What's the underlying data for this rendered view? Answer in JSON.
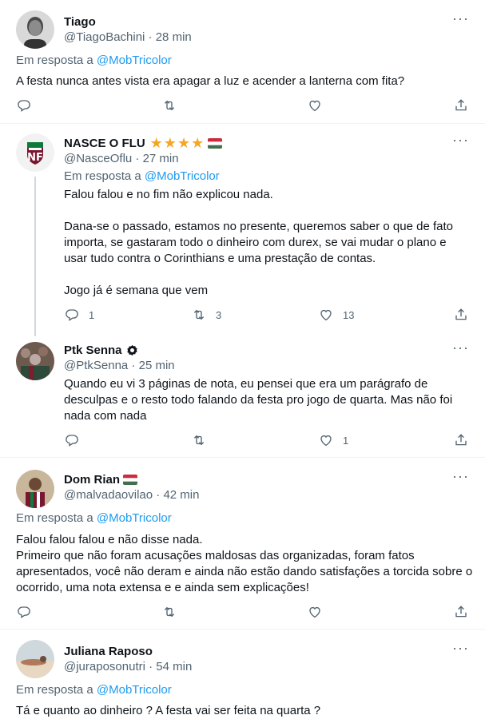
{
  "tweets": [
    {
      "name": "Tiago",
      "handle_time": "@TiagoBachini · 28 min",
      "reply_prefix": "Em resposta a",
      "reply_mention": "@MobTricolor",
      "text": "A festa nunca antes vista era apagar a luz e acender a lanterna com fita?",
      "replies": "",
      "retweets": "",
      "likes": ""
    },
    {
      "name": "NASCE O FLU",
      "handle_time": "@NasceOflu · 27 min",
      "reply_prefix": "Em resposta a",
      "reply_mention": "@MobTricolor",
      "text": "Falou falou e no fim não explicou nada.\n\nDana-se o passado, estamos no presente, queremos saber o que de fato importa, se gastaram todo o dinheiro com durex, se vai mudar o plano e usar tudo contra o Corinthians e uma prestação de contas.\n\nJogo já é semana que vem",
      "replies": "1",
      "retweets": "3",
      "likes": "13",
      "stars": "★★★★"
    },
    {
      "name": "Ptk Senna",
      "handle_time": "@PtkSenna · 25 min",
      "text": "Quando eu vi 3 páginas de nota, eu pensei que era um parágrafo de desculpas e o resto todo falando da festa pro jogo de quarta. Mas não foi nada com nada",
      "replies": "",
      "retweets": "",
      "likes": "1"
    },
    {
      "name": "Dom Rian",
      "handle_time": "@malvadaovilao · 42 min",
      "reply_prefix": "Em resposta a",
      "reply_mention": "@MobTricolor",
      "text": "Falou falou falou e não disse nada.\nPrimeiro que não foram acusações maldosas das organizadas, foram fatos apresentados, você não deram e ainda não estão dando satisfações a torcida sobre o ocorrido, uma nota extensa e e ainda sem explicações!",
      "replies": "",
      "retweets": "",
      "likes": ""
    },
    {
      "name": "Juliana Raposo",
      "handle_time": "@juraposonutri · 54 min",
      "reply_prefix": "Em resposta a",
      "reply_mention": "@MobTricolor",
      "text": "Tá e quanto ao dinheiro ? A festa vai ser feita na quarta ?"
    }
  ],
  "icons": {
    "reply": "reply-icon",
    "retweet": "retweet-icon",
    "like": "heart-icon",
    "share": "share-icon",
    "more": "more-icon"
  },
  "colors": {
    "accent": "#1d9bf0",
    "secondary_text": "#536471",
    "star": "#f5a623"
  }
}
